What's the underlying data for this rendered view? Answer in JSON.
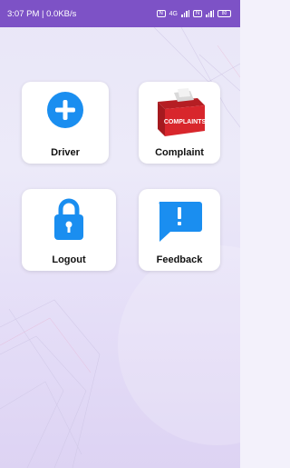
{
  "status_bar": {
    "time_speed": "3:07 PM | 0.0KB/s",
    "sim1": "N",
    "net": "4G",
    "sim2": "N",
    "battery": "80"
  },
  "menu": {
    "driver_label": "Driver",
    "complaint_label": "Complaint",
    "complaint_box_text": "COMPLAINTS",
    "logout_label": "Logout",
    "feedback_label": "Feedback"
  },
  "colors": {
    "status_bar": "#7d52c6",
    "icon_blue": "#1a8ef0",
    "complaint_red": "#d8262c"
  },
  "icons": [
    "plus-circle-icon",
    "complaint-box-icon",
    "lock-icon",
    "feedback-chat-icon"
  ]
}
